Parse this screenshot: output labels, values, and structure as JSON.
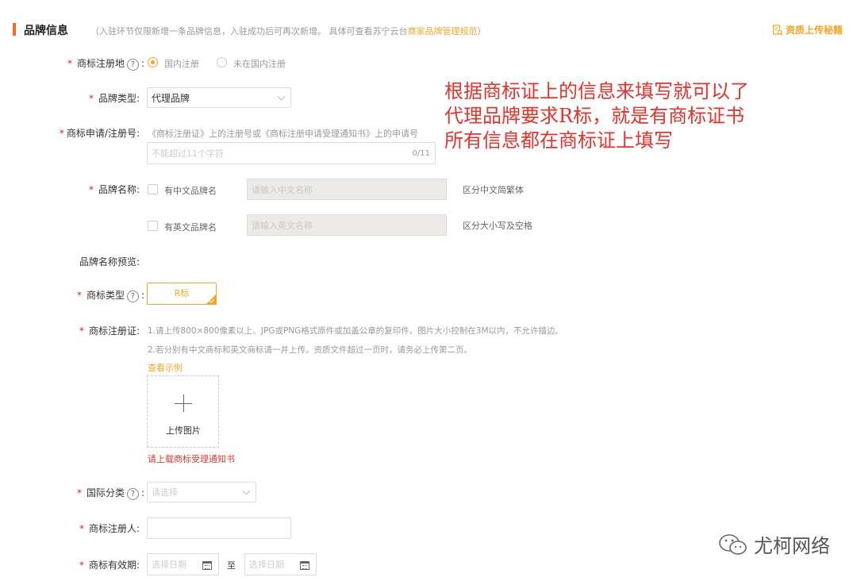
{
  "section": {
    "title": "品牌信息",
    "note_prefix": "（入驻环节仅限新增一条品牌信息，入驻成功后可再次新增。 具体可查看苏宁云台",
    "note_link": "商家品牌管理规范",
    "note_suffix": "）",
    "tips_label": "资质上传秘籍",
    "tips_icon": "document-search-icon"
  },
  "fields": {
    "reg_place": {
      "label": "商标注册地",
      "option_domestic": "国内注册",
      "option_foreign": "未在国内注册",
      "selected": "国内注册"
    },
    "brand_type": {
      "label": "品牌类型:",
      "value": "代理品牌"
    },
    "reg_number": {
      "label": "商标申请/注册号:",
      "hint": "《商标注册证》上的注册号或《商标注册申请受理通知书》上的申请号",
      "placeholder": "不能超过11个字符",
      "counter": "0/11"
    },
    "brand_name": {
      "label": "品牌名称:",
      "cn_checkbox": "有中文品牌名",
      "cn_placeholder": "请输入中文名称",
      "cn_hint": "区分中文简繁体",
      "en_checkbox": "有英文品牌名",
      "en_placeholder": "请输入英文名称",
      "en_hint": "区分大小写及空格"
    },
    "name_preview": {
      "label": "品牌名称预览:"
    },
    "mark_type": {
      "label": "商标类型",
      "option": "R标"
    },
    "certificate": {
      "label": "商标注册证:",
      "rule1": "1.请上传800×800像素以上、JPG或PNG格式原件或加盖公章的复印件。图片大小控制在3M以内，不允许描边。",
      "rule2": "2.若分别有中文商标和英文商标请一并上传。资质文件超过一页时，请务必上传第二页。",
      "example_link": "查看示例",
      "upload_label": "上传图片",
      "error": "请上载商标受理通知书"
    },
    "intl_class": {
      "label": "国际分类",
      "placeholder": "请选择"
    },
    "registrant": {
      "label": "商标注册人:"
    },
    "validity": {
      "label": "商标有效期:",
      "start_placeholder": "选择日期",
      "to": "至",
      "end_placeholder": "选择日期"
    }
  },
  "annotation": {
    "line1": "根据商标证上的信息来填写就可以了",
    "line2": "代理品牌要求R标，就是有商标证书",
    "line3": "所有信息都在商标证上填写"
  },
  "watermark": {
    "text": "尤柯网络",
    "icon": "wechat-icon"
  },
  "colors": {
    "accent": "#f5a623",
    "required": "#e02020",
    "annotation": "#e8312a",
    "section_bar": "#f56a1b"
  }
}
